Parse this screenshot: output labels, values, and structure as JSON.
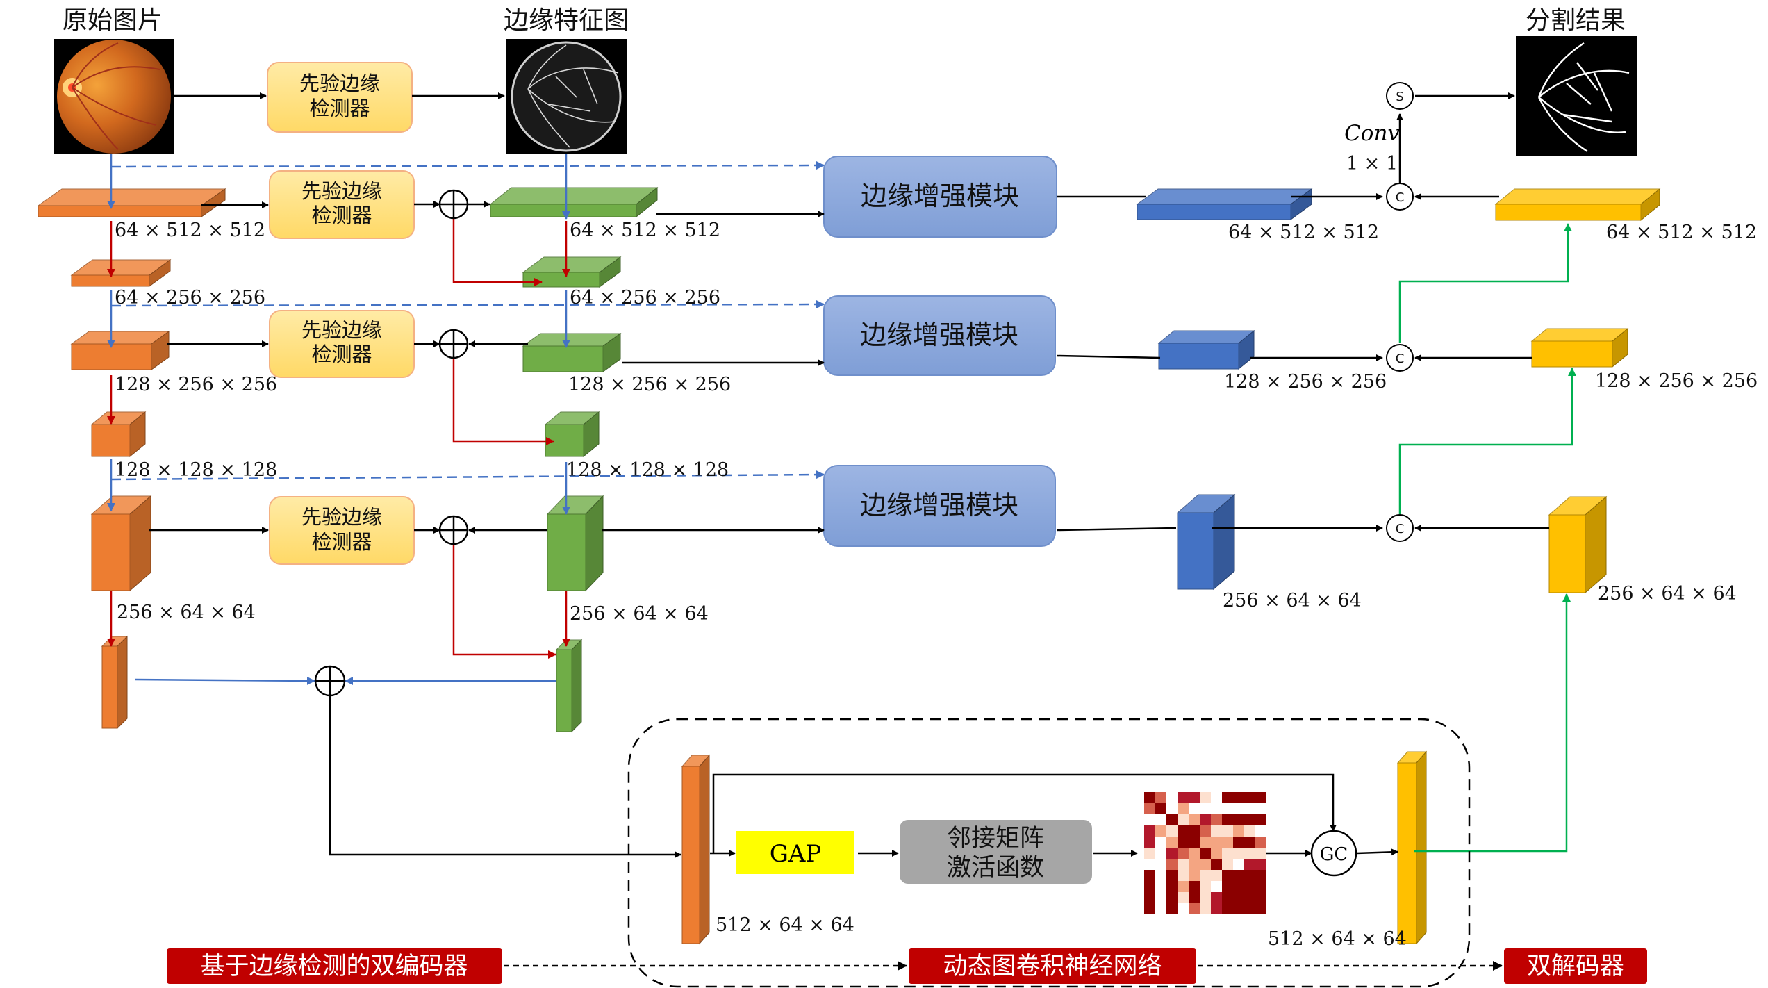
{
  "titles": {
    "original_image": "原始图片",
    "edge_feature_map": "边缘特征图",
    "segmentation_result": "分割结果"
  },
  "modules": {
    "prior_edge_detector_line1": "先验边缘",
    "prior_edge_detector_line2": "检测器",
    "edge_enhance_module": "边缘增强模块",
    "gap": "GAP",
    "adjacency_line1": "邻接矩阵",
    "adjacency_line2": "激活函数",
    "gc": "GC",
    "conv_label": "Conv",
    "conv_size": "1 × 1",
    "sigmoid_symbol": "S",
    "concat_symbol": "C"
  },
  "dims": {
    "d64_512": "64 × 512 × 512",
    "d64_256": "64 × 256 × 256",
    "d128_256": "128 × 256 × 256",
    "d128_128": "128 × 128 × 128",
    "d256_64": "256 × 64 × 64",
    "d512_64": "512 × 64 × 64"
  },
  "tags": {
    "encoder": "基于边缘检测的双编码器",
    "gcn": "动态图卷积神经网络",
    "decoder": "双解码器"
  },
  "colors": {
    "orange": "#ED7D31",
    "green": "#70AD47",
    "blue": "#4472C4",
    "gold": "#FFC000",
    "module_fill": "#8FAADC",
    "prior_fill": "#FFE699",
    "red_arrow": "#C00000",
    "blue_arrow": "#4472C4",
    "green_arrow": "#00B050",
    "tag_red": "#C00000",
    "gap_yellow": "#FFFF00",
    "adjacency_gray": "#A6A6A6"
  }
}
